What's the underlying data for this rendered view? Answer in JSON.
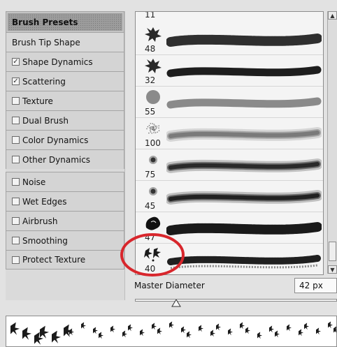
{
  "panel": {
    "options": [
      {
        "label": "Brush Presets",
        "type": "header"
      },
      {
        "label": "Brush Tip Shape",
        "type": "plain"
      },
      {
        "label": "Shape Dynamics",
        "type": "check",
        "checked": true
      },
      {
        "label": "Scattering",
        "type": "check",
        "checked": true
      },
      {
        "label": "Texture",
        "type": "check",
        "checked": false
      },
      {
        "label": "Dual Brush",
        "type": "check",
        "checked": false
      },
      {
        "label": "Color Dynamics",
        "type": "check",
        "checked": false
      },
      {
        "label": "Other Dynamics",
        "type": "check",
        "checked": false
      },
      {
        "label": "Noise",
        "type": "check",
        "checked": false
      },
      {
        "label": "Wet Edges",
        "type": "check",
        "checked": false
      },
      {
        "label": "Airbrush",
        "type": "check",
        "checked": false
      },
      {
        "label": "Smoothing",
        "type": "check",
        "checked": false
      },
      {
        "label": "Protect Texture",
        "type": "check",
        "checked": false
      }
    ]
  },
  "presets": {
    "partial_top_size": "11",
    "items": [
      {
        "size": "48",
        "tip": "scatter-leaf",
        "stroke": "rough",
        "color": "#2f2f2f"
      },
      {
        "size": "32",
        "tip": "maple-leaf",
        "stroke": "solid",
        "color": "#1e1e1e"
      },
      {
        "size": "55",
        "tip": "round-hard",
        "stroke": "solid",
        "color": "#8a8a8a"
      },
      {
        "size": "100",
        "tip": "spray",
        "stroke": "soft",
        "color": "#7a7a7a"
      },
      {
        "size": "75",
        "tip": "round-soft",
        "stroke": "soft",
        "color": "#2a2a2a"
      },
      {
        "size": "45",
        "tip": "round-soft",
        "stroke": "soft",
        "color": "#222222"
      },
      {
        "size": "47",
        "tip": "rose",
        "stroke": "rough",
        "color": "#1a1a1a"
      },
      {
        "size": "40",
        "tip": "holly",
        "stroke": "scatter",
        "color": "#202020"
      }
    ]
  },
  "master_diameter": {
    "label": "Master Diameter",
    "value": "42 px",
    "level_percent": 15
  },
  "colors": {
    "highlight": "#d8262c",
    "panel": "#d4d4d4"
  }
}
